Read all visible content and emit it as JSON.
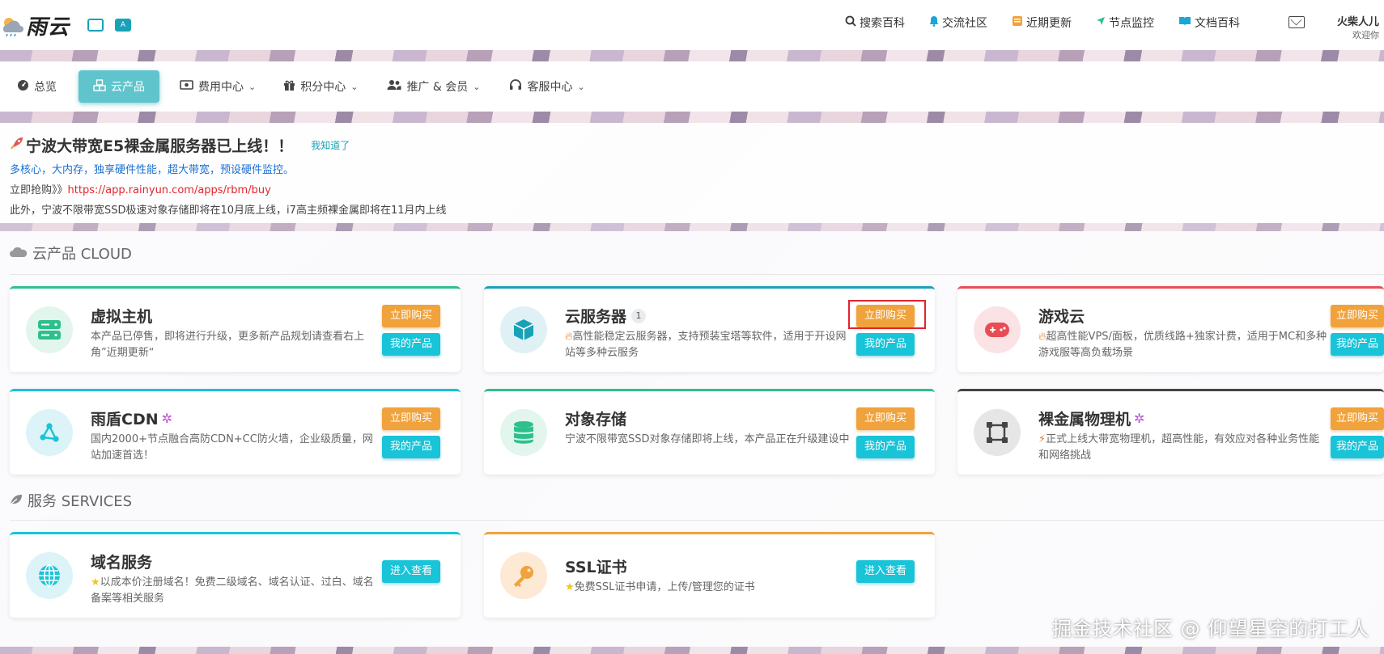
{
  "header": {
    "logo_text": "雨云",
    "nav": [
      {
        "icon": "search-icon",
        "label": "搜索百科"
      },
      {
        "icon": "bell-icon",
        "label": "交流社区"
      },
      {
        "icon": "news-icon",
        "label": "近期更新"
      },
      {
        "icon": "location-arrow-icon",
        "label": "节点监控"
      },
      {
        "icon": "book-icon",
        "label": "文档百科"
      }
    ],
    "user_name": "火柴人儿",
    "user_greeting": "欢迎你"
  },
  "mainnav": {
    "items": [
      {
        "icon": "dashboard-icon",
        "label": "总览"
      },
      {
        "icon": "cubes-icon",
        "label": "云产品"
      },
      {
        "icon": "money-icon",
        "label": "费用中心"
      },
      {
        "icon": "gift-icon",
        "label": "积分中心"
      },
      {
        "icon": "users-icon",
        "label": "推广 & 会员"
      },
      {
        "icon": "headset-icon",
        "label": "客服中心"
      }
    ]
  },
  "notice": {
    "title": "宁波大带宽E5裸金属服务器已上线！！",
    "dismiss": "我知道了",
    "line1": "多核心，大内存，独享硬件性能，超大带宽，预设硬件监控。",
    "line2_prefix": "立即抢购》》",
    "line2_link": "https://app.rainyun.com/apps/rbm/buy",
    "line3": "此外，宁波不限带宽SSD极速对象存储即将在10月底上线，i7高主频裸金属即将在11月内上线"
  },
  "cloud_section": {
    "title": "云产品 CLOUD",
    "cards": [
      {
        "name": "虚拟主机",
        "desc": "本产品已停售，即将进行升级，更多新产品规划请查看右上角”近期更新“",
        "buy": "立即购买",
        "mine": "我的产品",
        "icon": "server-icon",
        "color": "#2ec08c"
      },
      {
        "name": "云服务器",
        "badge": "1",
        "desc": "高性能稳定云服务器，支持预装宝塔等软件，适用于开设网站等多种云服务",
        "desc_icon": "fire-icon",
        "buy": "立即购买",
        "mine": "我的产品",
        "icon": "cube-icon",
        "color": "#17a2b8"
      },
      {
        "name": "游戏云",
        "desc": "超高性能VPS/面板，优质线路+独家计费，适用于MC和多种游戏服等高负载场景",
        "desc_icon": "fire-icon",
        "buy": "立即购买",
        "mine": "我的产品",
        "icon": "gamepad-icon",
        "color": "#e84d55"
      },
      {
        "name": "雨盾CDN",
        "desc": "国内2000+节点融合高防CDN+CC防火墙，企业级质量，网站加速首选！",
        "buy": "立即购买",
        "mine": "我的产品",
        "icon": "share-nodes-icon",
        "color": "#19c3d8"
      },
      {
        "name": "对象存储",
        "desc": "宁波不限带宽SSD对象存储即将上线，本产品正在升级建设中",
        "buy": "立即购买",
        "mine": "我的产品",
        "icon": "database-icon",
        "color": "#2ec08c"
      },
      {
        "name": "裸金属物理机",
        "desc": "正式上线大带宽物理机，超高性能，有效应对各种业务性能和网络挑战",
        "desc_icon": "bolt-icon",
        "buy": "立即购买",
        "mine": "我的产品",
        "icon": "vector-square-icon",
        "color": "#444444"
      }
    ]
  },
  "services_section": {
    "title": "服务 SERVICES",
    "cards": [
      {
        "name": "域名服务",
        "desc": "以成本价注册域名！免费二级域名、域名认证、过白、域名备案等相关服务",
        "desc_icon": "star-icon",
        "action": "进入查看",
        "icon": "globe-icon",
        "color": "#19c3d8"
      },
      {
        "name": "SSL证书",
        "desc": "免费SSL证书申请，上传/管理您的证书",
        "desc_icon": "star-icon",
        "action": "进入查看",
        "icon": "key-icon",
        "color": "#f0a23c"
      }
    ]
  },
  "watermark": "掘金技术社区 @ 仰望星空的打工人"
}
